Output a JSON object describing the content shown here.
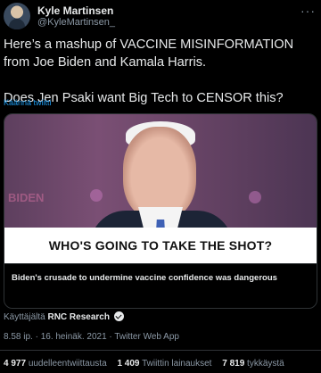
{
  "author": {
    "name": "Kyle Martinsen",
    "handle": "@KyleMartinsen_"
  },
  "tweet": {
    "line1": "Here’s a mashup of VACCINE MISINFORMATION from Joe Biden and Kamala Harris.",
    "line2": "Does Jen Psaki want Big Tech to CENSOR this?",
    "translate_label": "Käännä twiitti"
  },
  "media": {
    "caption": "WHO'S GOING TO TAKE THE SHOT?",
    "card_title": "Biden's crusade to undermine vaccine confidence was dangerous"
  },
  "source": {
    "prefix": "Käyttäjältä",
    "account": "RNC Research"
  },
  "meta": {
    "timestamp": "8.58 ip. · 16. heinäk. 2021 · Twitter Web App"
  },
  "stats": [
    {
      "count": "4 977",
      "label": "uudelleentwiittausta"
    },
    {
      "count": "1 409",
      "label": "Twiittin lainaukset"
    },
    {
      "count": "7 819",
      "label": "tykkäystä"
    }
  ],
  "icons": {
    "verified": "verified-badge-icon",
    "more": "more-options-icon"
  }
}
